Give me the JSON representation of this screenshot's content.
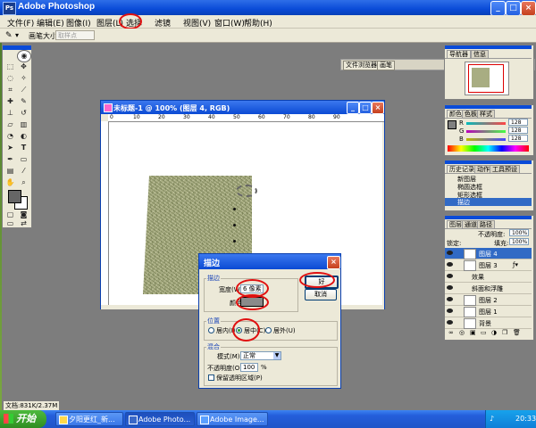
{
  "app": {
    "title": "Adobe Photoshop"
  },
  "menu": [
    "文件(F)",
    "编辑(E)",
    "图像(I)",
    "图层(L)",
    "选择",
    "滤镜",
    "视图(V)",
    "窗口(W)",
    "帮助(H)"
  ],
  "options_bar": {
    "brush_size_label": "画笔大小:",
    "field_value": "取样点",
    "panel_well_tabs": [
      "文件浏览器",
      "画笔"
    ]
  },
  "document": {
    "title": "未标题-1 @ 100% (图层 4, RGB)",
    "ruler_ticks": [
      "0",
      "10",
      "20",
      "30",
      "40",
      "50",
      "60",
      "70",
      "80",
      "90"
    ]
  },
  "status_bar": {
    "text": "文档:831K/2.37M"
  },
  "navigator": {
    "tabs": [
      "导航器",
      "信息"
    ]
  },
  "color_panel": {
    "tabs": [
      "颜色",
      "色板",
      "样式"
    ],
    "channels": [
      {
        "label": "R",
        "value": "128"
      },
      {
        "label": "G",
        "value": "128"
      },
      {
        "label": "B",
        "value": "128"
      }
    ]
  },
  "history": {
    "tabs": [
      "历史记录",
      "动作",
      "工具预设"
    ],
    "items": [
      "新图层",
      "椭圆选框",
      "矩形选框",
      "描边"
    ]
  },
  "layers_panel": {
    "tabs": [
      "图层",
      "通道",
      "路径"
    ],
    "opacity_label": "不透明度:",
    "opacity_value": "100%",
    "lock_label": "锁定:",
    "fill_label": "填充:",
    "fill_value": "100%",
    "layers": [
      {
        "name": "图层 4",
        "selected": true
      },
      {
        "name": "图层 3",
        "selected": false
      },
      {
        "name": "效果",
        "selected": false
      },
      {
        "name": "斜面和浮雕",
        "selected": false
      },
      {
        "name": "图层 2",
        "selected": false
      },
      {
        "name": "图层 1",
        "selected": false
      },
      {
        "name": "背景",
        "selected": false
      }
    ]
  },
  "dialog": {
    "title": "描边",
    "group_stroke": "描边",
    "width_label": "宽度(W):",
    "width_value": "6 像素",
    "color_label": "颜色:",
    "color_value": "#8a8a8a",
    "ok_label": "好",
    "cancel_label": "取消",
    "group_position": "位置",
    "position_options": [
      "居内(I)",
      "居中(C)",
      "居外(U)"
    ],
    "position_selected": "居中(C)",
    "group_blend": "混合",
    "mode_label": "模式(M):",
    "mode_value": "正常",
    "opacity_label": "不透明度(O):",
    "opacity_value": "100",
    "opacity_unit": "%",
    "preserve_label": "保留透明区域(P)"
  },
  "taskbar": {
    "start_label": "开始",
    "items": [
      "夕阳更红_新...",
      "Adobe Photo...",
      "Adobe Image..."
    ],
    "clock": "20:33"
  },
  "colors": {
    "highlight": "#e01010",
    "title_blue": "#0a4bd8",
    "workspace": "#7d7d7d"
  }
}
